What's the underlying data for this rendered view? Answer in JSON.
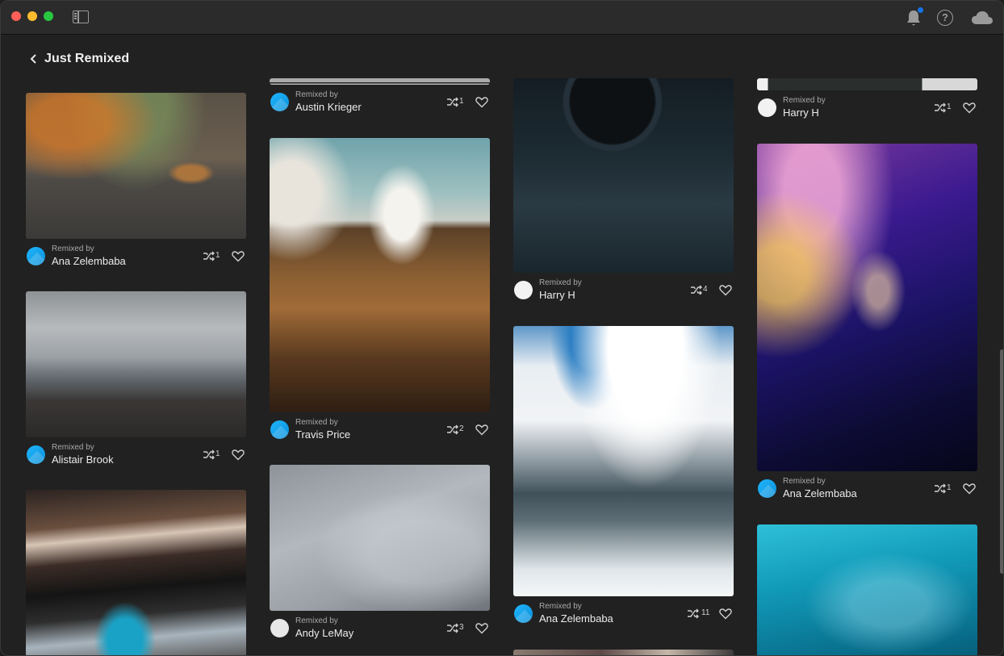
{
  "header": {
    "title": "Just Remixed"
  },
  "remixed_label": "Remixed by",
  "cards": [
    {
      "id": "c1",
      "author": "Ana Zelembaba",
      "remixes": "1"
    },
    {
      "id": "c2",
      "author": "Alistair Brook",
      "remixes": "1"
    },
    {
      "id": "c3",
      "author": "Austin Krieger",
      "remixes": "1"
    },
    {
      "id": "c4",
      "author": "Travis Price",
      "remixes": "2"
    },
    {
      "id": "c5",
      "author": "Andy LeMay",
      "remixes": "3"
    },
    {
      "id": "c6",
      "author": "Harry H",
      "remixes": "4"
    },
    {
      "id": "c7",
      "author": "Ana Zelembaba",
      "remixes": "11"
    },
    {
      "id": "c8",
      "author": "Harry H",
      "remixes": "1"
    },
    {
      "id": "c9",
      "author": "Ana Zelembaba",
      "remixes": "1"
    }
  ],
  "icons": {
    "titlebar": [
      "sidebar-toggle-icon",
      "notification-bell-icon",
      "help-icon",
      "cloud-icon"
    ],
    "card": [
      "remix-icon",
      "heart-icon"
    ]
  },
  "colors": {
    "accent": "#1473e6",
    "avatar": "#1fb6ff",
    "background": "#212121"
  }
}
